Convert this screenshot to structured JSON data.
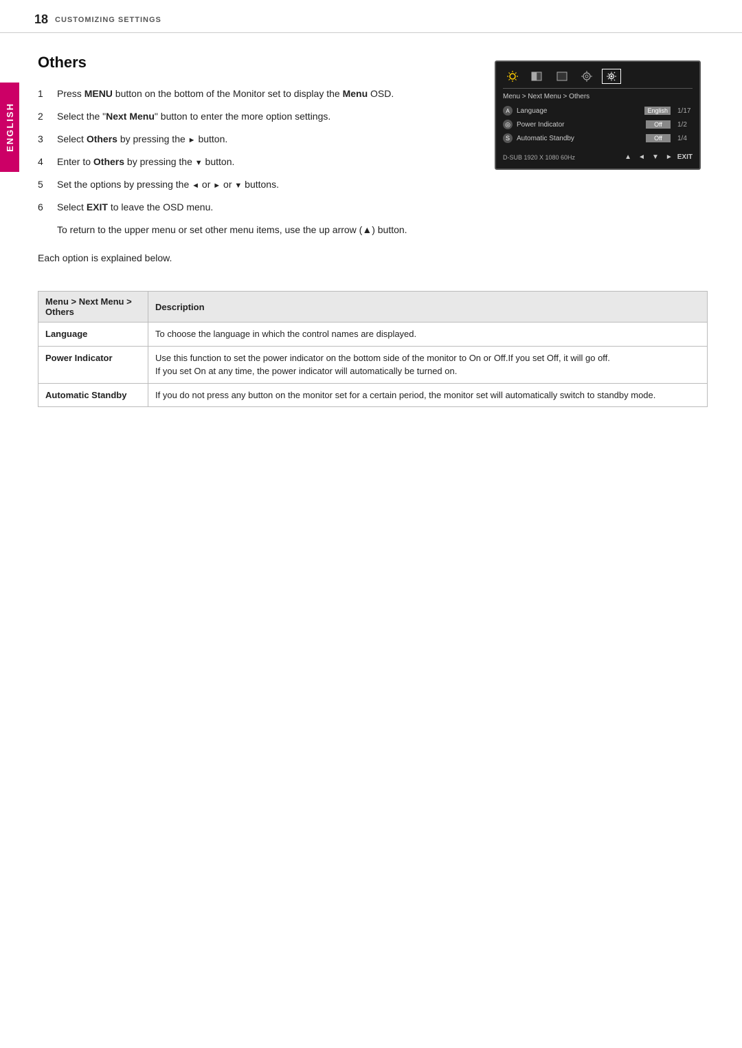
{
  "header": {
    "page_number": "18",
    "title": "CUSTOMIZING SETTINGS"
  },
  "side_tab": {
    "label": "ENGLISH"
  },
  "section": {
    "title": "Others",
    "steps": [
      {
        "number": "1",
        "text": "Press ",
        "bold1": "MENU",
        "text2": " button on the bottom of the Monitor set to display the ",
        "bold2": "Menu",
        "text3": " OSD."
      },
      {
        "number": "2",
        "text": "Select the \"",
        "bold1": "Next Menu",
        "text2": "\" button to enter the more option settings."
      },
      {
        "number": "3",
        "text": "Select ",
        "bold1": "Others",
        "text2": " by pressing the ► button."
      },
      {
        "number": "4",
        "text": "Enter to ",
        "bold1": "Others",
        "text2": " by pressing the ▼ button."
      },
      {
        "number": "5",
        "text": "Set the options by pressing the ◄ or ► or ▼ buttons."
      },
      {
        "number": "6",
        "text": "Select ",
        "bold1": "EXIT",
        "text2": " to leave the OSD menu.",
        "sub": "To return to the upper menu or set other menu items, use the up arrow (▲) button."
      }
    ],
    "each_option_label": "Each option is explained below."
  },
  "osd": {
    "breadcrumb": "Menu > Next Menu > Others",
    "items": [
      {
        "icon_char": "A",
        "label": "Language",
        "value": "English",
        "fraction": "1/17"
      },
      {
        "icon_char": "◎",
        "label": "Power Indicator",
        "value": "Off",
        "fraction": "1/2"
      },
      {
        "icon_char": "S",
        "label": "Automatic Standby",
        "value": "Off",
        "fraction": "1/4"
      }
    ],
    "resolution": "D-SUB 1920 X 1080 60Hz",
    "nav_buttons": [
      "▲",
      "◄",
      "▼",
      "►"
    ],
    "exit_label": "EXIT"
  },
  "table": {
    "col1_header": "Menu > Next Menu > Others",
    "col2_header": "Description",
    "rows": [
      {
        "label": "Language",
        "description": "To choose the language in which the control names are displayed."
      },
      {
        "label": "Power Indicator",
        "description": "Use this function to set the power indicator on the bottom side of the monitor to On or Off.If you set Off, it will go off.\nIf you set On at any time, the power indicator will automatically be turned on."
      },
      {
        "label": "Automatic Standby",
        "description": "If you do not press any button on the monitor set for a certain period, the monitor set will automatically switch to standby mode."
      }
    ]
  }
}
